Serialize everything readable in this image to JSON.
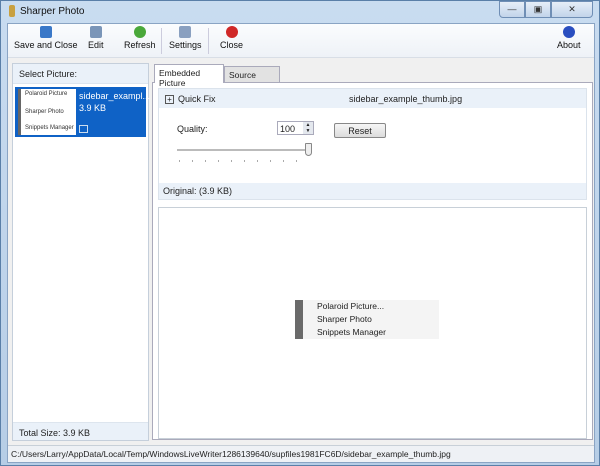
{
  "window": {
    "title": "Sharper Photo",
    "min": "—",
    "max": "▣",
    "close": "✕"
  },
  "toolbar": {
    "save_close": "Save and Close",
    "edit": "Edit",
    "refresh": "Refresh",
    "settings": "Settings",
    "close": "Close",
    "about": "About"
  },
  "left": {
    "header": "Select Picture:",
    "item": {
      "name": "sidebar_exampl...",
      "size": "3.9 KB"
    },
    "thumb_lines": [
      "Polaroid Picture",
      "Sharper Photo",
      "Snippets Manager"
    ],
    "total": "Total Size: 3.9 KB"
  },
  "tabs": [
    "Embedded Picture",
    "Source Picture"
  ],
  "quickfix": {
    "title": "Quick Fix",
    "filename": "sidebar_example_thumb.jpg",
    "quality_label": "Quality:",
    "quality_value": "100",
    "quality_fraction": 1.0,
    "reset": "Reset",
    "original": "Original: (3.9 KB)"
  },
  "preview": {
    "lines": [
      "Polaroid Picture...",
      "Sharper Photo",
      "Snippets Manager"
    ]
  },
  "status": "C:/Users/Larry/AppData/Local/Temp/WindowsLiveWriter1286139640/supfiles1981FC6D/sidebar_example_thumb.jpg"
}
